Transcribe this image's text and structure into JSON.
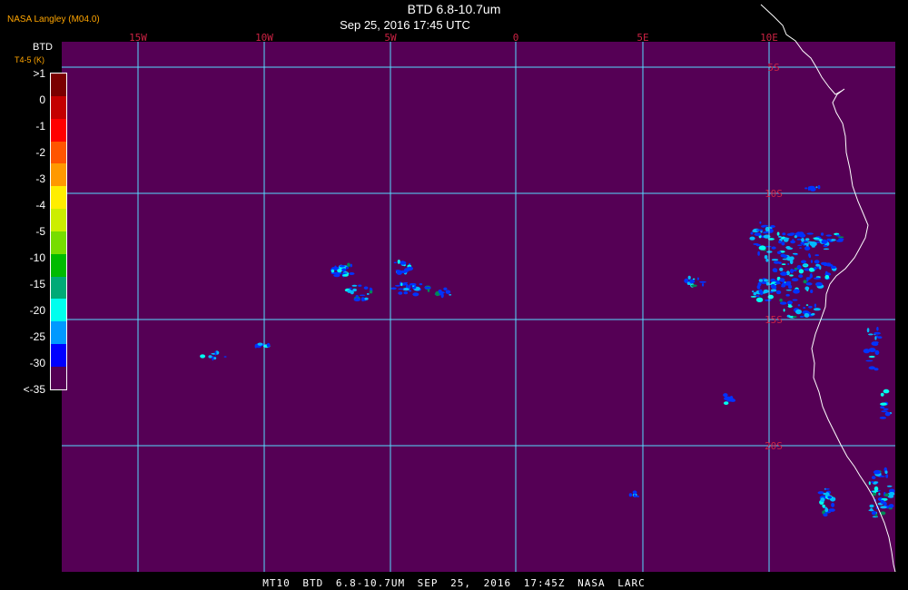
{
  "header": {
    "credit": "NASA Langley (M04.0)",
    "title": "BTD 6.8-10.7um",
    "datetime": "Sep 25, 2016 17:45 UTC"
  },
  "legend": {
    "title": "BTD",
    "subtitle": "T4-5 (K)",
    "labels": [
      ">1",
      "0",
      "-1",
      "-2",
      "-3",
      "-4",
      "-5",
      "-10",
      "-15",
      "-20",
      "-25",
      "-30",
      "<-35"
    ],
    "colors": [
      "#7a0000",
      "#c40000",
      "#ff0000",
      "#ff5500",
      "#ff9900",
      "#ffee00",
      "#ccee00",
      "#77dd00",
      "#00bb00",
      "#00aa77",
      "#00ffee",
      "#0099ff",
      "#0000ff",
      "#550055"
    ]
  },
  "map": {
    "background_color": "#550055",
    "grid_color": "#55ddff",
    "coast_color": "#ffffff",
    "cloud_colors": [
      "#0033ff",
      "#00bbff",
      "#00ffee",
      "#008855"
    ],
    "lon_labels": [
      "15W",
      "10W",
      "5W",
      "0",
      "5E",
      "10E"
    ],
    "lat_labels": [
      "5S",
      "10S",
      "15S",
      "20S"
    ],
    "label_color": "#cc2244"
  },
  "footer": {
    "text": "MT10  BTD 6.8-10.7UM  SEP 25, 2016 17:45Z  NASA LARC"
  }
}
